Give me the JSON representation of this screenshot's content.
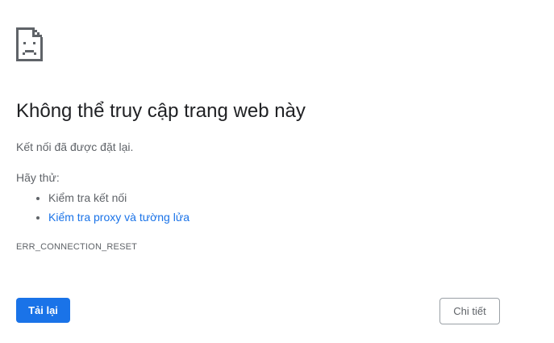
{
  "error_page": {
    "icon": "sad-page-icon",
    "title": "Không thể truy cập trang web này",
    "summary": "Kết nối đã được đặt lại.",
    "try_label": "Hãy thử:",
    "suggestions": [
      {
        "label": "Kiểm tra kết nối",
        "is_link": false
      },
      {
        "label": "Kiểm tra proxy và tường lửa",
        "is_link": true
      }
    ],
    "error_code": "ERR_CONNECTION_RESET",
    "reload_label": "Tải lại",
    "details_label": "Chi tiết"
  },
  "colors": {
    "primary": "#1a73e8",
    "text": "#202124",
    "secondary_text": "#5f6368"
  }
}
